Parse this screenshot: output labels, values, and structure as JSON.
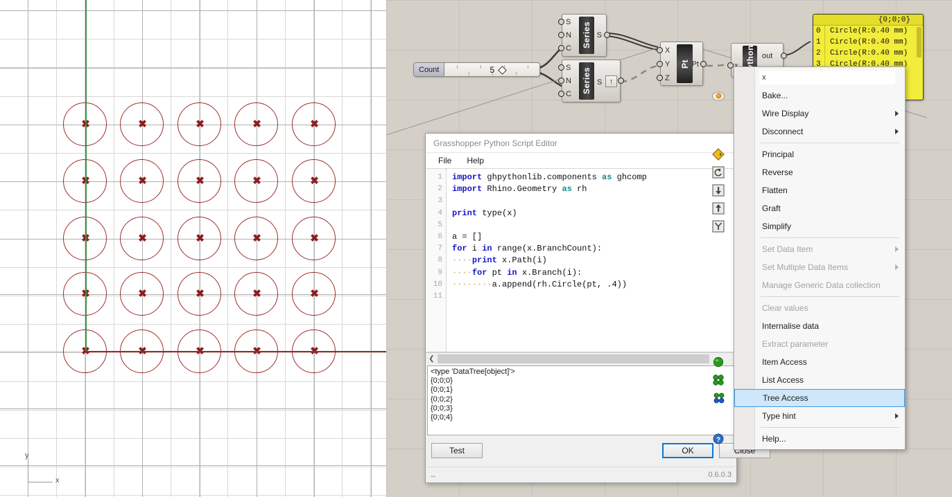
{
  "viewport": {
    "axis_labels": {
      "x": "x",
      "y": "y"
    },
    "circle_count": 25,
    "grid_rows": 5,
    "grid_cols": 5
  },
  "canvas": {
    "slider": {
      "name": "Count",
      "value": "5"
    },
    "components": [
      {
        "name": "Series",
        "inputs": [
          "S",
          "N",
          "C"
        ],
        "output": "S"
      },
      {
        "name": "Series",
        "inputs": [
          "S",
          "N",
          "C"
        ],
        "output": "S"
      },
      {
        "name": "Pt",
        "inputs": [
          "X",
          "Y",
          "Z"
        ],
        "output": "Pt"
      },
      {
        "name": "Python",
        "inputs": [
          "x"
        ],
        "output": "out"
      }
    ],
    "data_preview": {
      "path": "{0;0;0}",
      "rows": [
        {
          "index": "0",
          "value": "Circle(R:0.40 mm)"
        },
        {
          "index": "1",
          "value": "Circle(R:0.40 mm)"
        },
        {
          "index": "2",
          "value": "Circle(R:0.40 mm)"
        },
        {
          "index": "3",
          "value": "Circle(R:0.40 mm)"
        }
      ]
    }
  },
  "script_editor": {
    "title": "Grasshopper Python Script Editor",
    "menu": [
      {
        "label": "File"
      },
      {
        "label": "Help"
      }
    ],
    "code_lines": [
      {
        "num": "1",
        "html": "<span class='kw'>import</span> ghpythonlib.components <span class='as'>as</span> ghcomp"
      },
      {
        "num": "2",
        "html": "<span class='kw'>import</span> Rhino.Geometry <span class='as'>as</span> rh"
      },
      {
        "num": "3",
        "html": ""
      },
      {
        "num": "4",
        "html": "<span class='kw'>print</span> type(x)"
      },
      {
        "num": "5",
        "html": ""
      },
      {
        "num": "6",
        "html": "a = []"
      },
      {
        "num": "7",
        "html": "<span class='kw'>for</span> i <span class='kw'>in</span> range(x.BranchCount):"
      },
      {
        "num": "8",
        "html": "<span class='ind'>····</span><span class='kw'>print</span> x.Path(i)"
      },
      {
        "num": "9",
        "html": "<span class='ind'>····</span><span class='kw'>for</span> pt <span class='kw'>in</span> x.Branch(i):"
      },
      {
        "num": "10",
        "html": "<span class='ind'>········</span>a.append(rh.Circle(pt, .4))"
      },
      {
        "num": "11",
        "html": ""
      }
    ],
    "code_plain": [
      "import ghpythonlib.components as ghcomp",
      "import Rhino.Geometry as rh",
      "",
      "print type(x)",
      "",
      "a = []",
      "for i in range(x.BranchCount):",
      "    print x.Path(i)",
      "    for pt in x.Branch(i):",
      "        a.append(rh.Circle(pt, .4))",
      ""
    ],
    "output_lines": [
      "<type 'DataTree[object]'>",
      "{0;0;0}",
      "{0;0;1}",
      "{0;0;2}",
      "{0;0;3}",
      "{0;0;4}"
    ],
    "buttons": {
      "test": "Test",
      "ok": "OK",
      "close": "Close"
    },
    "status": {
      "left": "...",
      "version": "0.6.0.3"
    }
  },
  "context_menu": {
    "header": "x",
    "items": [
      {
        "label": "Bake...",
        "icon": "bake-egg-icon",
        "disabled": false,
        "submenu": false,
        "selected": false
      },
      {
        "label": "Wire Display",
        "icon": null,
        "disabled": false,
        "submenu": true,
        "selected": false
      },
      {
        "label": "Disconnect",
        "icon": null,
        "disabled": false,
        "submenu": true,
        "selected": false
      },
      {
        "sep": true
      },
      {
        "label": "Principal",
        "icon": "principal-diamond-icon",
        "disabled": false,
        "submenu": false,
        "selected": false
      },
      {
        "label": "Reverse",
        "icon": "reverse-icon",
        "disabled": false,
        "submenu": false,
        "selected": false
      },
      {
        "label": "Flatten",
        "icon": "flatten-down-arrow-icon",
        "disabled": false,
        "submenu": false,
        "selected": false
      },
      {
        "label": "Graft",
        "icon": "graft-up-arrow-icon",
        "disabled": false,
        "submenu": false,
        "selected": false
      },
      {
        "label": "Simplify",
        "icon": "simplify-icon",
        "disabled": false,
        "submenu": false,
        "selected": false
      },
      {
        "sep": true
      },
      {
        "label": "Set Data Item",
        "icon": null,
        "disabled": true,
        "submenu": true,
        "selected": false
      },
      {
        "label": "Set Multiple Data Items",
        "icon": null,
        "disabled": true,
        "submenu": true,
        "selected": false
      },
      {
        "label": "Manage Generic Data collection",
        "icon": null,
        "disabled": true,
        "submenu": false,
        "selected": false
      },
      {
        "sep": true
      },
      {
        "label": "Clear values",
        "icon": null,
        "disabled": true,
        "submenu": false,
        "selected": false
      },
      {
        "label": "Internalise data",
        "icon": null,
        "disabled": false,
        "submenu": false,
        "selected": false
      },
      {
        "label": "Extract parameter",
        "icon": null,
        "disabled": true,
        "submenu": false,
        "selected": false
      },
      {
        "label": "Item Access",
        "icon": "item-access-sphere-icon",
        "disabled": false,
        "submenu": false,
        "selected": false
      },
      {
        "label": "List Access",
        "icon": "list-access-icon",
        "disabled": false,
        "submenu": false,
        "selected": false
      },
      {
        "label": "Tree Access",
        "icon": "tree-access-icon",
        "disabled": false,
        "submenu": false,
        "selected": true
      },
      {
        "label": "Type hint",
        "icon": null,
        "disabled": false,
        "submenu": true,
        "selected": false
      },
      {
        "sep": true
      },
      {
        "label": "Help...",
        "icon": "help-question-icon",
        "disabled": false,
        "submenu": false,
        "selected": false
      }
    ]
  },
  "colors": {
    "circle_stroke": "#9e2b2b",
    "axis_x": "#9c2a28",
    "axis_y": "#3f8f3f",
    "canvas_bg": "#d4d0c8",
    "preview_yellow": "#f2ec3a",
    "selection_blue": "#cfe7fb",
    "keyword_blue": "#1414c8",
    "as_teal": "#1a8a8a"
  }
}
